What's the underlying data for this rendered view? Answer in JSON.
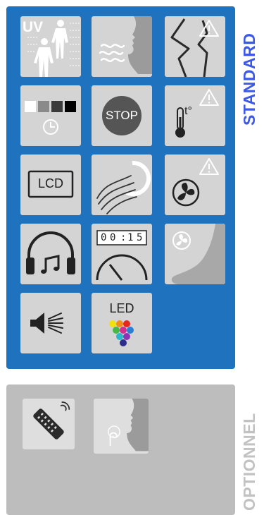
{
  "panels": {
    "standard": {
      "title": "STANDARD"
    },
    "optional": {
      "title": "OPTIONNEL"
    }
  },
  "tiles": {
    "uv": {
      "label": "UV"
    },
    "stop": {
      "label": "STOP"
    },
    "temperature": {
      "label": "t°"
    },
    "lcd": {
      "label": "LCD"
    },
    "timer": {
      "digits": [
        "0",
        "0",
        "1",
        "5"
      ]
    },
    "led": {
      "label": "LED"
    }
  },
  "colors": {
    "standard_panel": "#1f72bd",
    "optional_panel": "#bdbdbd",
    "standard_title": "#3b58e8",
    "optional_title": "#c2c2c2",
    "tile": "#d4d4d4"
  }
}
